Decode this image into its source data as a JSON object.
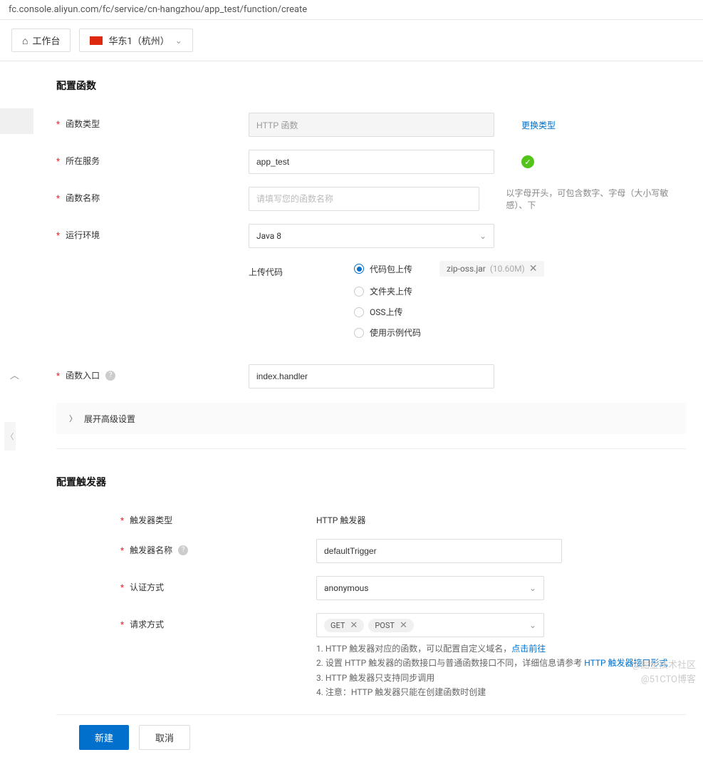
{
  "url": "fc.console.aliyun.com/fc/service/cn-hangzhou/app_test/function/create",
  "topbar": {
    "workbench": "工作台",
    "region": "华东1（杭州）"
  },
  "sections": {
    "configure_function": "配置函数",
    "configure_trigger": "配置触发器"
  },
  "labels": {
    "function_type": "函数类型",
    "service": "所在服务",
    "function_name": "函数名称",
    "runtime": "运行环境",
    "upload_code": "上传代码",
    "entrypoint": "函数入口",
    "trigger_type": "触发器类型",
    "trigger_name": "触发器名称",
    "auth_type": "认证方式",
    "request_method": "请求方式"
  },
  "values": {
    "function_type": "HTTP 函数",
    "service": "app_test",
    "runtime": "Java 8",
    "entrypoint": "index.handler",
    "trigger_type_text": "HTTP 触发器",
    "trigger_name": "defaultTrigger",
    "auth_type": "anonymous",
    "methods": [
      "GET",
      "POST"
    ]
  },
  "placeholders": {
    "function_name": "请填写您的函数名称"
  },
  "links": {
    "change_type": "更换类型",
    "goto_domain": "点击前往",
    "http_trigger_form": "HTTP 触发器接口形式"
  },
  "hints": {
    "function_name": "以字母开头，可包含数字、字母（大小写敏感）、下"
  },
  "upload": {
    "options": {
      "code_package": "代码包上传",
      "folder": "文件夹上传",
      "oss": "OSS上传",
      "sample": "使用示例代码"
    },
    "selected": "code_package",
    "file": {
      "name": "zip-oss.jar",
      "size": "(10.60M)"
    }
  },
  "expand": "展开高级设置",
  "notes": {
    "n1_prefix": "1. HTTP 触发器对应的函数，可以配置自定义域名，",
    "n2_prefix": "2. 设置 HTTP 触发器的函数接口与普通函数接口不同，详细信息请参考 ",
    "n3": "3. HTTP 触发器只支持同步调用",
    "n4": "4. 注意：HTTP 触发器只能在创建函数时创建"
  },
  "buttons": {
    "create": "新建",
    "cancel": "取消"
  },
  "watermark": {
    "line1": "@掘金技术社区",
    "line2": "@51CTO博客"
  }
}
